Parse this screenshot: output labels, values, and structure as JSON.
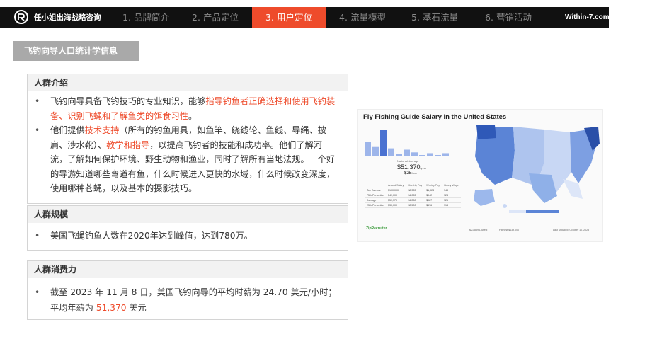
{
  "header": {
    "brand": "任小姐出海战略咨询",
    "site": "Within-7.com",
    "tabs": [
      {
        "label": "1. 品牌简介",
        "active": false
      },
      {
        "label": "2. 产品定位",
        "active": false
      },
      {
        "label": "3. 用户定位",
        "active": true
      },
      {
        "label": "4. 流量模型",
        "active": false
      },
      {
        "label": "5. 基石流量",
        "active": false
      },
      {
        "label": "6. 营销活动",
        "active": false
      }
    ],
    "accent_color": "#ee4b2b"
  },
  "section_title": "飞钓向导人口统计学信息",
  "cards": {
    "intro": {
      "title": "人群介绍",
      "b1_pre": "飞钓向导具备飞钓技巧的专业知识，能够",
      "b1_hl": "指导钓鱼者正确选择和使用飞钓装备、识别飞蝇和了解鱼类的饵食习性",
      "b1_post": "。",
      "b2_pre": "他们提供",
      "b2_hl1": "技术支持",
      "b2_mid": "（所有的钓鱼用具，如鱼竿、绕线轮、鱼线、导绳、披肩、涉水靴）、",
      "b2_hl2": "教学和指导",
      "b2_post": "，以提高飞钓者的技能和成功率。他们了解河流，了解如何保护环境、野生动物和渔业，同时了解所有当地法规。一个好的导游知道哪些弯道有鱼，什么时候进入更快的水域，什么时候改变深度，使用哪种苍蝇，以及基本的摄影技巧。"
    },
    "scale": {
      "title": "人群规模",
      "b1": "美国飞蝇钓鱼人数在2020年达到峰值，达到780万。"
    },
    "consumption": {
      "title": "人群消费力",
      "b1_pre": "截至 2023 年 11 月 8 日，美国飞钓向导的平均时薪为 24.70 美元/小时；平均年薪为 ",
      "b1_hl": "51,370",
      "b1_post": " 美元"
    }
  },
  "salary_image": {
    "title": "Fly Fishing Guide Salary in the United States",
    "national_avg_label": "National Average",
    "annual": "$51,370",
    "annual_unit": "/year",
    "hourly": "$25",
    "hourly_unit": "/hour",
    "histogram": [
      0.55,
      0.35,
      1.0,
      0.3,
      0.1,
      0.25,
      0.15,
      0.05,
      0.12,
      0.05,
      0.12
    ],
    "table": {
      "headers": [
        "",
        "Annual Salary",
        "Monthly Pay",
        "Weekly Pay",
        "Hourly Wage"
      ],
      "rows": [
        [
          "Top Earners",
          "$100,000",
          "$8,333",
          "$1,923",
          "$48"
        ],
        [
          "75th Percentile",
          "$49,000",
          "$4,083",
          "$942",
          "$24"
        ],
        [
          "Average",
          "$51,370",
          "$4,280",
          "$987",
          "$25"
        ],
        [
          "25th Percentile",
          "$30,000",
          "$2,500",
          "$576",
          "$14"
        ]
      ]
    },
    "logo": "ZipRecruiter",
    "legend_low": "$21,839 Lowest",
    "legend_high": "Highest $139,000",
    "updated": "Last Updated: October 10, 2023"
  }
}
